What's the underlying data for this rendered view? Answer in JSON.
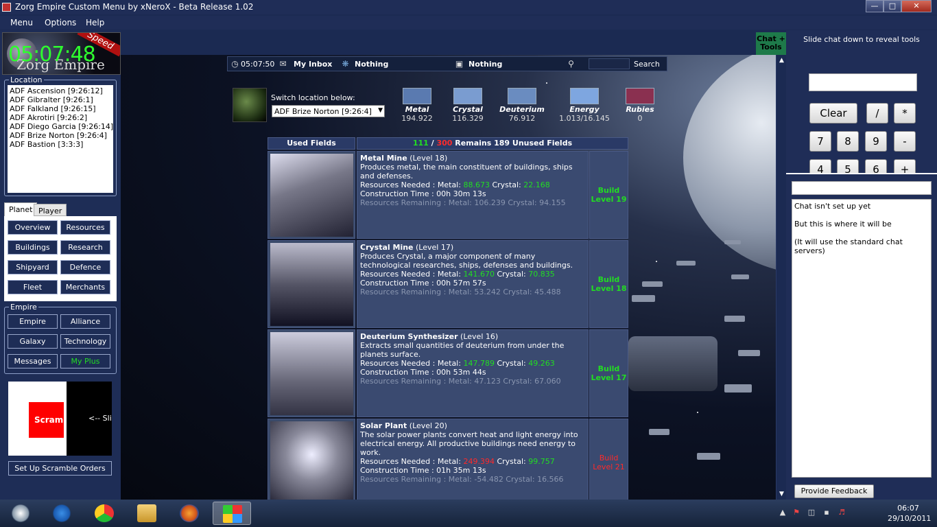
{
  "window": {
    "title": "Zorg Empire Custom Menu by xNeroX - Beta Release 1.02"
  },
  "menu": [
    "Menu",
    "Options",
    "Help"
  ],
  "logo": {
    "clock": "05:07:48",
    "brand": "Zorg Empire",
    "speed": "Speed"
  },
  "location": {
    "legend": "Location",
    "items": [
      "ADF Ascension [9:26:12]",
      "ADF Gibralter [9:26:1]",
      "ADF Falkland [9:26:15]",
      "ADF Akrotiri [9:26:2]",
      "ADF Diego Garcia [9:26:14]",
      "ADF Brize Norton [9:26:4]",
      "ADF Bastion [3:3:3]"
    ]
  },
  "tabs": {
    "planet": "Planet",
    "player": "Player"
  },
  "planet_buttons": [
    "Overview",
    "Resources",
    "Buildings",
    "Research",
    "Shipyard",
    "Defence",
    "Fleet",
    "Merchants"
  ],
  "empire": {
    "legend": "Empire",
    "buttons": [
      "Empire",
      "Alliance",
      "Galaxy",
      "Technology",
      "Messages",
      "My Plus"
    ]
  },
  "scramble": {
    "red_label": "Scramble",
    "slide_label": "<-- Slide",
    "setup_button": "Set Up Scramble Orders"
  },
  "chat_tools": "Chat + Tools",
  "infobar": {
    "time": "05:07:50",
    "inbox": "My Inbox",
    "nothing1": "Nothing",
    "nothing2": "Nothing",
    "search": "Search"
  },
  "switch": {
    "label": "Switch location below:",
    "selected": "ADF Brize Norton [9:26:4]"
  },
  "resources": [
    {
      "name": "Metal",
      "value": "194.922",
      "color": "#8fb0d8"
    },
    {
      "name": "Crystal",
      "value": "116.329",
      "color": "#9ab4dc"
    },
    {
      "name": "Deuterium",
      "value": "76.912",
      "color": "#a8bcdc"
    },
    {
      "name": "Energy",
      "value": "1.013/16.145",
      "color": "#b0c4e8"
    },
    {
      "name": "Rubies",
      "value": "0",
      "color": "#a04060"
    }
  ],
  "fields": {
    "used_label": "Used Fields",
    "used": "111",
    "slash": " / ",
    "max": "300",
    "remains": " Remains 189 Unused Fields"
  },
  "buildings": [
    {
      "name": "Metal Mine",
      "level": " (Level 18)",
      "desc": "Produces metal, the main constituent of buildings, ships and defenses.",
      "need_label": "Resources Needed : Metal: ",
      "need_metal": "88.673",
      "crystal_label": " Crystal: ",
      "need_crystal": "22.168",
      "time": "Construction Time : 00h 30m 13s",
      "remain": "Resources Remaining : Metal: 106.239 Crystal: 94.155",
      "action": "Build Level 19",
      "action_color": "#22dd22",
      "metal_color": "#22dd22"
    },
    {
      "name": "Crystal Mine",
      "level": " (Level 17)",
      "desc": "Produces Crystal, a major component of many technological researches, ships, defenses and buildings.",
      "need_label": "Resources Needed : Metal: ",
      "need_metal": "141.670",
      "crystal_label": " Crystal: ",
      "need_crystal": "70.835",
      "time": "Construction Time : 00h 57m 57s",
      "remain": "Resources Remaining : Metal: 53.242 Crystal: 45.488",
      "action": "Build Level 18",
      "action_color": "#22dd22",
      "metal_color": "#22dd22"
    },
    {
      "name": "Deuterium Synthesizer",
      "level": " (Level 16)",
      "desc": "Extracts small quantities of deuterium from under the planets surface.",
      "need_label": "Resources Needed : Metal: ",
      "need_metal": "147.789",
      "crystal_label": " Crystal: ",
      "need_crystal": "49.263",
      "time": "Construction Time : 00h 53m 44s",
      "remain": "Resources Remaining : Metal: 47.123 Crystal: 67.060",
      "action": "Build Level 17",
      "action_color": "#22dd22",
      "metal_color": "#22dd22"
    },
    {
      "name": "Solar Plant",
      "level": " (Level 20)",
      "desc": "The solar power plants convert heat and light energy into electrical energy. All productive buildings need energy to work.",
      "need_label": "Resources Needed : Metal: ",
      "need_metal": "249.394",
      "crystal_label": " Crystal: ",
      "need_crystal": "99.757",
      "time": "Construction Time : 01h 35m 13s",
      "remain": "Resources Remaining : Metal: -54.482 Crystal: 16.566",
      "action": "Build Level 21",
      "action_color": "#ff2a2a",
      "metal_color": "#ff2a2a"
    }
  ],
  "right": {
    "slide_text": "Slide chat down to reveal tools",
    "calc": {
      "clear": "Clear",
      "div": "/",
      "mul": "*",
      "minus": "-",
      "plus": "+",
      "n7": "7",
      "n8": "8",
      "n9": "9",
      "n4": "4",
      "n5": "5",
      "n6": "6"
    },
    "chat_lines": [
      "Chat isn't set up yet",
      "But this is where it will be",
      "(It will use the standard chat servers)"
    ],
    "feedback": "Provide Feedback"
  },
  "taskbar": {
    "time": "06:07",
    "date": "29/10/2011"
  }
}
